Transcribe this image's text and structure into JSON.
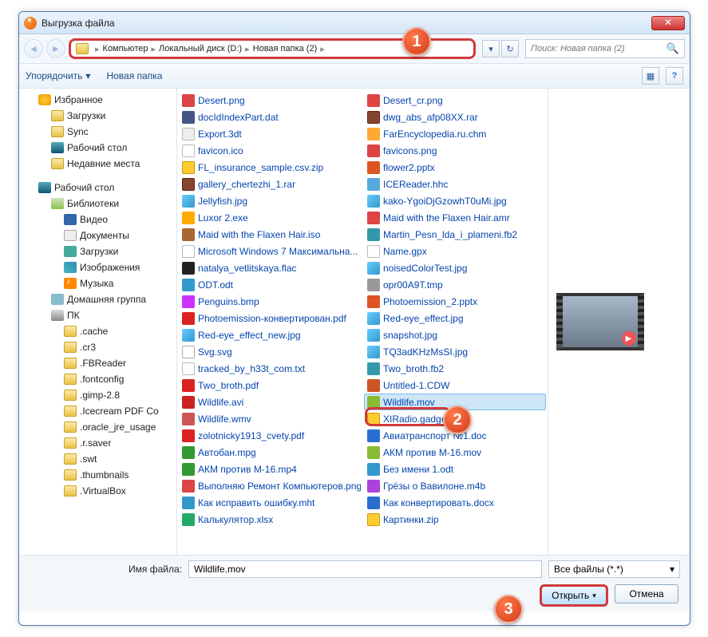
{
  "title": "Выгрузка файла",
  "breadcrumbs": [
    "Компьютер",
    "Локальный диск (D:)",
    "Новая папка (2)"
  ],
  "search_placeholder": "Поиск: Новая папка (2)",
  "toolbar": {
    "organize": "Упорядочить",
    "newfolder": "Новая папка"
  },
  "tree": {
    "favorites": "Избранное",
    "downloads": "Загрузки",
    "sync": "Sync",
    "desktop": "Рабочий стол",
    "recent": "Недавние места",
    "desktop2": "Рабочий стол",
    "libs": "Библиотеки",
    "video": "Видео",
    "docs": "Документы",
    "dl2": "Загрузки",
    "images": "Изображения",
    "music": "Музыка",
    "homegroup": "Домашняя группа",
    "pc": "ПК",
    "folders": [
      ".cache",
      ".cr3",
      ".FBReader",
      ".fontconfig",
      ".gimp-2.8",
      ".Icecream PDF Co",
      ".oracle_jre_usage",
      ".r.saver",
      ".swt",
      ".thumbnails",
      ".VirtualBox"
    ]
  },
  "files_col1": [
    {
      "n": "Desert.png",
      "i": "i-png"
    },
    {
      "n": "docIdIndexPart.dat",
      "i": "i-dat"
    },
    {
      "n": "Export.3dt",
      "i": "i-3dt"
    },
    {
      "n": "favicon.ico",
      "i": "i-ico"
    },
    {
      "n": "FL_insurance_sample.csv.zip",
      "i": "i-zip"
    },
    {
      "n": "gallery_chertezhi_1.rar",
      "i": "i-rar"
    },
    {
      "n": "Jellyfish.jpg",
      "i": "i-jpg"
    },
    {
      "n": "Luxor 2.exe",
      "i": "i-exe"
    },
    {
      "n": "Maid with the Flaxen Hair.iso",
      "i": "i-iso"
    },
    {
      "n": "Microsoft Windows 7 Максимальна...",
      "i": "i-txt"
    },
    {
      "n": "natalya_vetlitskaya.flac",
      "i": "i-flac"
    },
    {
      "n": "ODT.odt",
      "i": "i-odt"
    },
    {
      "n": "Penguins.bmp",
      "i": "i-bmp"
    },
    {
      "n": "Photoemission-конвертирован.pdf",
      "i": "i-pdf"
    },
    {
      "n": "Red-eye_effect_new.jpg",
      "i": "i-jpg"
    },
    {
      "n": "Svg.svg",
      "i": "i-svg"
    },
    {
      "n": "tracked_by_h33t_com.txt",
      "i": "i-txt"
    },
    {
      "n": "Two_broth.pdf",
      "i": "i-pdf"
    },
    {
      "n": "Wildlife.avi",
      "i": "i-avi"
    },
    {
      "n": "Wildlife.wmv",
      "i": "i-wmv"
    },
    {
      "n": "zolotnicky1913_cvety.pdf",
      "i": "i-pdf"
    },
    {
      "n": "Автобан.mpg",
      "i": "i-mpg"
    },
    {
      "n": "АКМ против М-16.mp4",
      "i": "i-mp4"
    },
    {
      "n": "Выполняю Ремонт Компьютеров.png",
      "i": "i-png"
    },
    {
      "n": "Как исправить ошибку.mht",
      "i": "i-mht"
    },
    {
      "n": "Калькулятор.xlsx",
      "i": "i-xlsx"
    }
  ],
  "files_col2": [
    {
      "n": "Desert_cr.png",
      "i": "i-png"
    },
    {
      "n": "dwg_abs_afp08XX.rar",
      "i": "i-rar"
    },
    {
      "n": "FarEncyclopedia.ru.chm",
      "i": "i-chm"
    },
    {
      "n": "favicons.png",
      "i": "i-png"
    },
    {
      "n": "flower2.pptx",
      "i": "i-pptx"
    },
    {
      "n": "ICEReader.hhc",
      "i": "i-hhc"
    },
    {
      "n": "kako-YgoiDjGzowhT0uMi.jpg",
      "i": "i-jpg"
    },
    {
      "n": "Maid with the Flaxen Hair.amr",
      "i": "i-amr"
    },
    {
      "n": "Martin_Pesn_lda_i_plameni.fb2",
      "i": "i-fb2"
    },
    {
      "n": "Name.gpx",
      "i": "i-gpx"
    },
    {
      "n": "noisedColorTest.jpg",
      "i": "i-jpg"
    },
    {
      "n": "opr00A9T.tmp",
      "i": "i-tmp"
    },
    {
      "n": "Photoemission_2.pptx",
      "i": "i-pptx"
    },
    {
      "n": "Red-eye_effect.jpg",
      "i": "i-jpg"
    },
    {
      "n": "snapshot.jpg",
      "i": "i-jpg"
    },
    {
      "n": "TQ3adKHzMsSI.jpg",
      "i": "i-jpg"
    },
    {
      "n": "Two_broth.fb2",
      "i": "i-fb2"
    },
    {
      "n": "Untitled-1.CDW",
      "i": "i-cdw"
    },
    {
      "n": "Wildlife.mov",
      "i": "i-mov",
      "sel": true
    },
    {
      "n": "XIRadio.gadget.zip",
      "i": "i-zip"
    },
    {
      "n": "Авиатранспорт №1.doc",
      "i": "i-doc2"
    },
    {
      "n": "АКМ против М-16.mov",
      "i": "i-mov"
    },
    {
      "n": "Без имени 1.odt",
      "i": "i-odt"
    },
    {
      "n": "Грёзы о Вавилоне.m4b",
      "i": "i-m4b"
    },
    {
      "n": "Как конвертировать.docx",
      "i": "i-docx"
    },
    {
      "n": "Картинки.zip",
      "i": "i-zip"
    }
  ],
  "bottom": {
    "filename_label": "Имя файла:",
    "filename_value": "Wildlife.mov",
    "filter": "Все файлы (*.*)",
    "open": "Открыть",
    "cancel": "Отмена"
  },
  "callouts": {
    "c1": "1",
    "c2": "2",
    "c3": "3"
  }
}
